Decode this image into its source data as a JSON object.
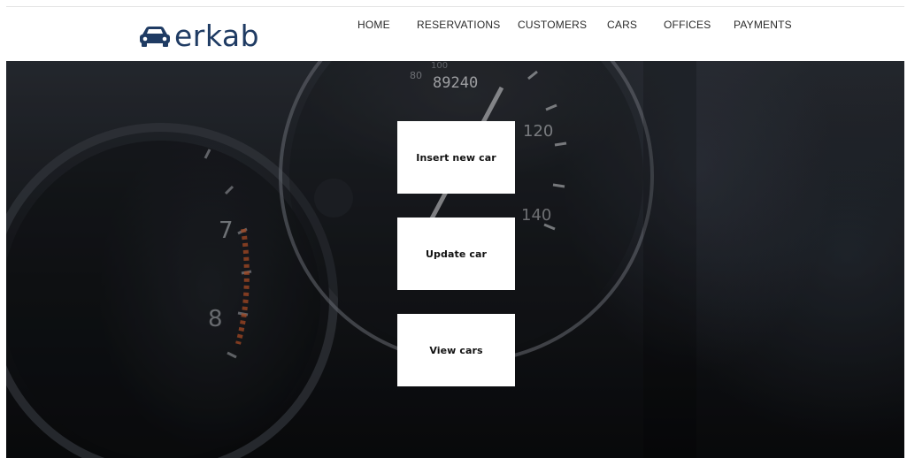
{
  "brand": {
    "name": "erkab",
    "icon": "car-icon",
    "color": "#1f3b63"
  },
  "nav": {
    "items": [
      {
        "label": "HOME"
      },
      {
        "label": "RESERVATIONS"
      },
      {
        "label": "CUSTOMERS"
      },
      {
        "label": "CARS"
      },
      {
        "label": "OFFICES"
      },
      {
        "label": "PAYMENTS"
      }
    ]
  },
  "hero": {
    "background": "car dashboard speedometer photo",
    "gauge_text": {
      "odometer": "89240",
      "speed_80": "80",
      "speed_100": "100",
      "speed_120": "120",
      "speed_140": "140",
      "rpm_7": "7",
      "rpm_8": "8"
    }
  },
  "actions": {
    "insert_label": "Insert new car",
    "update_label": "Update car",
    "view_label": "View cars"
  }
}
